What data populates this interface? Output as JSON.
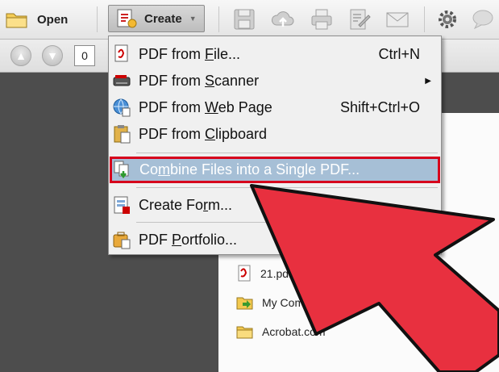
{
  "toolbar": {
    "open_label": "Open",
    "create_label": "Create"
  },
  "nav": {
    "page_number": "0"
  },
  "menu": {
    "items": [
      {
        "pre": "PDF from ",
        "u": "F",
        "post": "ile...",
        "shortcut": "Ctrl+N"
      },
      {
        "pre": "PDF from ",
        "u": "S",
        "post": "canner",
        "shortcut": ""
      },
      {
        "pre": "PDF from ",
        "u": "W",
        "post": "eb Page",
        "shortcut": "Shift+Ctrl+O"
      },
      {
        "pre": "PDF from ",
        "u": "C",
        "post": "lipboard",
        "shortcut": ""
      },
      {
        "pre": "Co",
        "u": "m",
        "post": "bine Files into a Single PDF...",
        "shortcut": ""
      },
      {
        "pre": "Create Fo",
        "u": "r",
        "post": "m...",
        "shortcut": ""
      },
      {
        "pre": "PDF ",
        "u": "P",
        "post": "ortfolio...",
        "shortcut": ""
      }
    ]
  },
  "recent": {
    "items": [
      {
        "label": "21.pdf",
        "icon": "pdf-file-icon"
      },
      {
        "label": "My Computer...",
        "icon": "open-folder-icon"
      },
      {
        "label": "Acrobat.com",
        "icon": "folder-icon"
      }
    ]
  },
  "colors": {
    "highlight": "#a6bfd6",
    "annotation_red": "#d6001c",
    "arrow_fill": "#e8303f"
  }
}
